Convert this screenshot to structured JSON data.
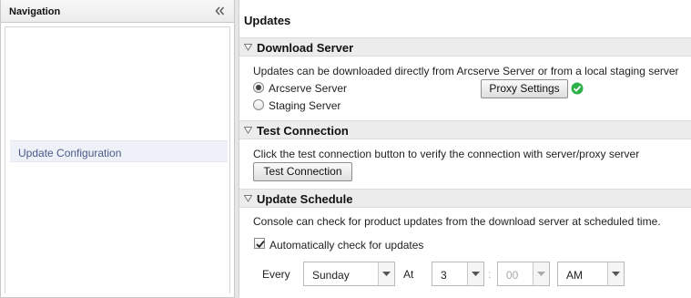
{
  "navigation": {
    "title": "Navigation",
    "items": [
      {
        "label": "Update Configuration"
      }
    ]
  },
  "content": {
    "title": "Updates",
    "download_server": {
      "header": "Download Server",
      "description": "Updates can be downloaded directly from Arcserve Server or from a local staging server",
      "options": [
        {
          "label": "Arcserve Server",
          "selected": true
        },
        {
          "label": "Staging Server",
          "selected": false
        }
      ],
      "proxy_button": "Proxy Settings",
      "proxy_status": "ok-check-icon"
    },
    "test_connection": {
      "header": "Test Connection",
      "description": "Click the test connection button to verify the connection with server/proxy server",
      "button": "Test Connection"
    },
    "update_schedule": {
      "header": "Update Schedule",
      "description": "Console can check for product updates from the download server at scheduled time.",
      "auto_check_label": "Automatically check for updates",
      "auto_check_checked": true,
      "every_label": "Every",
      "day": "Sunday",
      "at_label": "At",
      "hour": "3",
      "colon": ":",
      "minute": "00",
      "ampm": "AM"
    }
  },
  "colors": {
    "success": "#2fb14a",
    "nav_item_text": "#4a5a8a",
    "section_bg": "#ececec"
  }
}
